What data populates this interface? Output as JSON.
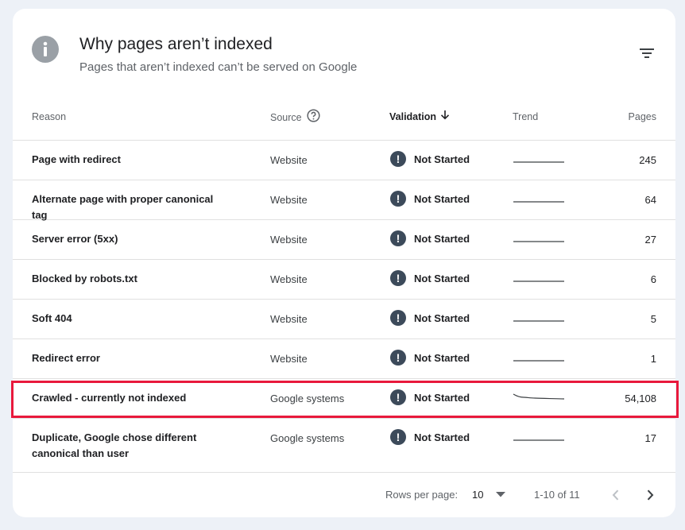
{
  "card": {
    "title": "Why pages aren’t indexed",
    "subtitle": "Pages that aren’t indexed can’t be served on Google"
  },
  "columns": {
    "reason": "Reason",
    "source": "Source",
    "validation": "Validation",
    "trend": "Trend",
    "pages": "Pages"
  },
  "rows": [
    {
      "reason": "Page with redirect",
      "source": "Website",
      "validation": "Not Started",
      "pages": "245"
    },
    {
      "reason": "Alternate page with proper canonical tag",
      "source": "Website",
      "validation": "Not Started",
      "pages": "64"
    },
    {
      "reason": "Server error (5xx)",
      "source": "Website",
      "validation": "Not Started",
      "pages": "27"
    },
    {
      "reason": "Blocked by robots.txt",
      "source": "Website",
      "validation": "Not Started",
      "pages": "6"
    },
    {
      "reason": "Soft 404",
      "source": "Website",
      "validation": "Not Started",
      "pages": "5"
    },
    {
      "reason": "Redirect error",
      "source": "Website",
      "validation": "Not Started",
      "pages": "1"
    },
    {
      "reason": "Crawled - currently not indexed",
      "source": "Google systems",
      "validation": "Not Started",
      "pages": "54,108"
    },
    {
      "reason": "Duplicate, Google chose different canonical than user",
      "source": "Google systems",
      "validation": "Not Started",
      "pages": "17"
    }
  ],
  "footer": {
    "rows_per_page_label": "Rows per page:",
    "rows_per_page_value": "10",
    "range": "1-10 of 11"
  },
  "colors": {
    "highlight": "#e8193c",
    "status_icon": "#3c4a5a",
    "info_icon": "#9aa0a6"
  },
  "icons": [
    "info-icon",
    "filter-icon",
    "help-icon",
    "sort-arrow-down-icon",
    "exclamation-icon",
    "chevron-down-icon",
    "chevron-left-icon",
    "chevron-right-icon"
  ]
}
